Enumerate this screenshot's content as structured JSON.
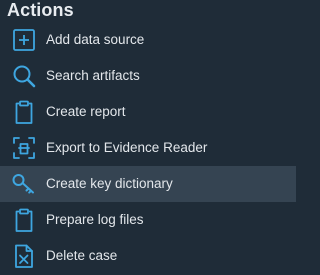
{
  "panel": {
    "title": "Actions"
  },
  "colors": {
    "background": "#1f2c38",
    "selected_row": "#354452",
    "icon_accent": "#3ea6e0",
    "text": "#e3e7eb"
  },
  "actions": [
    {
      "label": "Add data source",
      "icon": "add-square-icon"
    },
    {
      "label": "Search artifacts",
      "icon": "magnifier-icon"
    },
    {
      "label": "Create report",
      "icon": "clipboard-icon"
    },
    {
      "label": "Export to Evidence Reader",
      "icon": "scan-export-icon"
    },
    {
      "label": "Create key dictionary",
      "icon": "key-icon",
      "selected": true
    },
    {
      "label": "Prepare log files",
      "icon": "clipboard-icon"
    },
    {
      "label": "Delete case",
      "icon": "delete-document-icon"
    }
  ]
}
